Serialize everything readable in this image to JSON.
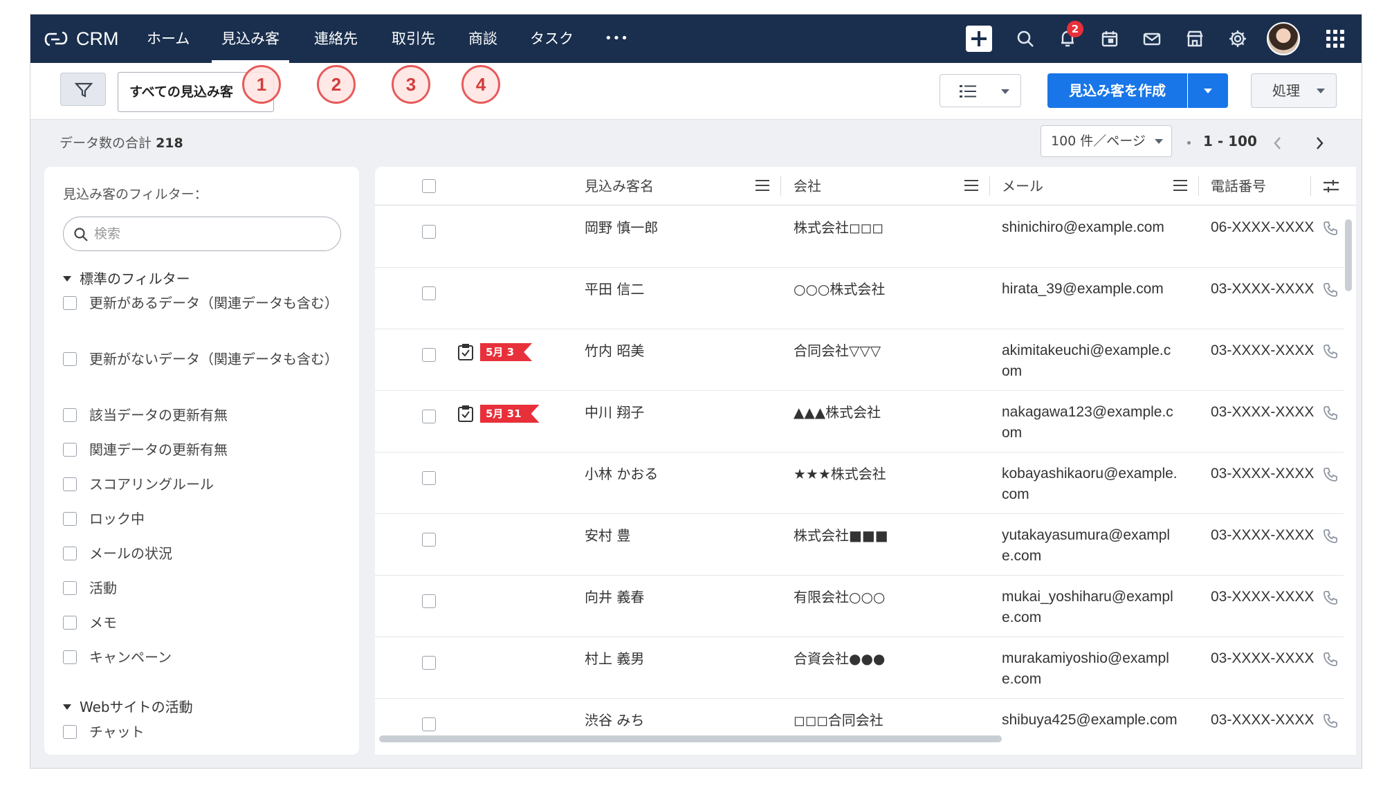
{
  "app": {
    "name": "CRM"
  },
  "nav": {
    "tabs": [
      {
        "label": "ホーム"
      },
      {
        "label": "見込み客"
      },
      {
        "label": "連絡先"
      },
      {
        "label": "取引先"
      },
      {
        "label": "商談"
      },
      {
        "label": "タスク"
      },
      {
        "label": "•••"
      }
    ],
    "active_tab": "見込み客",
    "notification_count": "2"
  },
  "toolbar": {
    "view_selector_label": "すべての見込み客",
    "create_button_label": "見込み客を作成",
    "action_button_label": "処理",
    "markers": [
      "1",
      "2",
      "3",
      "4"
    ]
  },
  "summary": {
    "total_label": "データ数の合計",
    "total_count": "218",
    "page_size_label": "100 件／ページ",
    "page_range": "1 - 100"
  },
  "filters": {
    "title": "見込み客のフィルター：",
    "search_placeholder": "検索",
    "standard_section": "標準のフィルター",
    "standard_items": [
      "更新があるデータ（関連データも含む）",
      "更新がないデータ（関連データも含む）",
      "該当データの更新有無",
      "関連データの更新有無",
      "スコアリングルール",
      "ロック中",
      "メールの状況",
      "活動",
      "メモ",
      "キャンペーン"
    ],
    "web_section": "Webサイトの活動",
    "web_items": [
      "チャット"
    ]
  },
  "table": {
    "columns": {
      "name": "見込み客名",
      "company": "会社",
      "email": "メール",
      "phone": "電話番号"
    },
    "rows": [
      {
        "name": "岡野 慎一郎",
        "company": "株式会社◻◻◻",
        "email": "shinichiro@example.com",
        "phone": "06-XXXX-XXXX",
        "task_date": ""
      },
      {
        "name": "平田 信二",
        "company": "○○○株式会社",
        "email": "hirata_39@example.com",
        "phone": "03-XXXX-XXXX",
        "task_date": ""
      },
      {
        "name": "竹内 昭美",
        "company": "合同会社▽▽▽",
        "email": "akimitakeuchi@example.com",
        "phone": "03-XXXX-XXXX",
        "task_date": "5月 3"
      },
      {
        "name": "中川 翔子",
        "company": "▲▲▲株式会社",
        "email": "nakagawa123@example.com",
        "phone": "03-XXXX-XXXX",
        "task_date": "5月 31"
      },
      {
        "name": "小林 かおる",
        "company": "★★★株式会社",
        "email": "kobayashikaoru@example.com",
        "phone": "03-XXXX-XXXX",
        "task_date": ""
      },
      {
        "name": "安村 豊",
        "company": "株式会社■■■",
        "email": "yutakayasumura@example.com",
        "phone": "03-XXXX-XXXX",
        "task_date": ""
      },
      {
        "name": "向井 義春",
        "company": "有限会社○○○",
        "email": "mukai_yoshiharu@example.com",
        "phone": "03-XXXX-XXXX",
        "task_date": ""
      },
      {
        "name": "村上 義男",
        "company": "合資会社●●●",
        "email": "murakamiyoshio@example.com",
        "phone": "03-XXXX-XXXX",
        "task_date": ""
      },
      {
        "name": "渋谷 みち",
        "company": "◻◻◻合同会社",
        "email": "shibuya425@example.com",
        "phone": "03-XXXX-XXXX",
        "task_date": ""
      }
    ]
  },
  "colors": {
    "nav_bg": "#1a2f4e",
    "primary": "#1876e8",
    "badge": "#e8303a",
    "marker": "#e65a59"
  },
  "icons": [
    "crm-logo-icon",
    "filter-icon",
    "list-view-icon",
    "plus-icon",
    "search-icon",
    "bell-icon",
    "calendar-icon",
    "mail-icon",
    "store-icon",
    "gear-icon",
    "apps-grid-icon",
    "task-check-icon",
    "phone-icon",
    "column-settings-icon"
  ]
}
